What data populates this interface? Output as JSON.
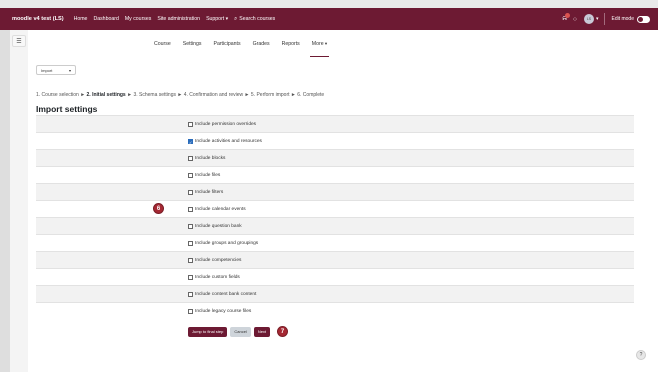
{
  "navbar": {
    "brand": "moodle v4 test (LS)",
    "links": [
      "Home",
      "Dashboard",
      "My courses",
      "Site administration",
      "Support",
      "Search courses"
    ],
    "avatar_initials": "LS",
    "edit_mode_label": "Edit mode",
    "bell_icon": "bell-icon",
    "chat_icon": "chat-icon"
  },
  "drawer_toggle": "☰",
  "secondary_nav": {
    "tabs": [
      "Course",
      "Settings",
      "Participants",
      "Grades",
      "Reports",
      "More"
    ]
  },
  "import_select": {
    "value": "Import"
  },
  "steps": {
    "step1": "1. Course selection ►",
    "step2": "2. Initial settings",
    "rest": "► 3. Schema settings ► 4. Confirmation and review ► 5. Perform import ► 6. Complete"
  },
  "heading": "Import settings",
  "settings": [
    {
      "label": "Include permission overrides",
      "checked": false
    },
    {
      "label": "Include activities and resources",
      "checked": true
    },
    {
      "label": "Include blocks",
      "checked": false
    },
    {
      "label": "Include files",
      "checked": false
    },
    {
      "label": "Include filters",
      "checked": false
    },
    {
      "label": "Include calendar events",
      "checked": false
    },
    {
      "label": "Include question bank",
      "checked": false
    },
    {
      "label": "Include groups and groupings",
      "checked": false
    },
    {
      "label": "Include competencies",
      "checked": false
    },
    {
      "label": "Include custom fields",
      "checked": false
    },
    {
      "label": "Include content bank content",
      "checked": false
    },
    {
      "label": "Include legacy course files",
      "checked": false
    }
  ],
  "markers": {
    "m6": "6",
    "m7": "7"
  },
  "buttons": {
    "jump": "Jump to final step",
    "cancel": "Cancel",
    "next": "Next"
  },
  "help": "?",
  "colors": {
    "brand": "#6d1a33",
    "marker": "#a52833",
    "checkbox": "#2a6cbb"
  }
}
